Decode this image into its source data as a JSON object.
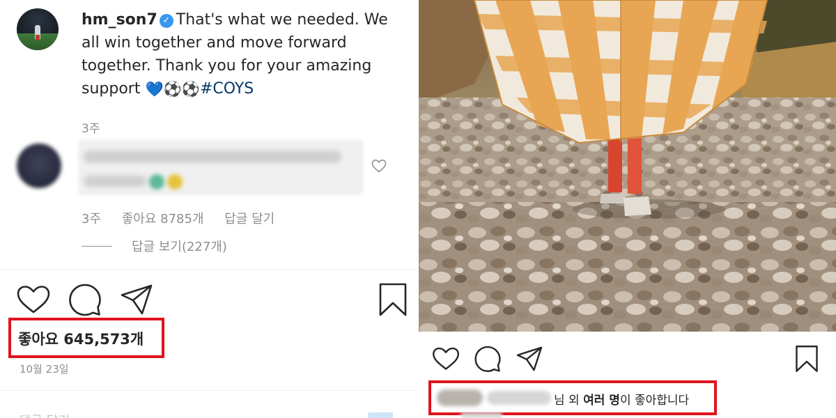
{
  "left_post": {
    "username": "hm_son7",
    "caption_text": "That's what we needed. We all win together and move forward together. Thank you for your amazing support",
    "emojis": [
      "💙",
      "⚽",
      "⚽"
    ],
    "hashtag": "#COYS",
    "caption_time": "3주",
    "comment": {
      "time": "3주",
      "likes": "좋아요 8785개",
      "reply_label": "답글 달기",
      "view_replies": "답글 보기(227개)"
    },
    "likes": "좋아요 645,573개",
    "date": "10월 23일",
    "cut_text": "댓글 달기..."
  },
  "right_post": {
    "likes_suffix_1": "님 외 ",
    "likes_bold": "여러 명",
    "likes_suffix_2": "이 좋아합니다"
  },
  "icons": {
    "like": "heart-icon",
    "comment": "comment-icon",
    "share": "send-icon",
    "save": "bookmark-icon",
    "verified": "verified-badge-icon"
  },
  "colors": {
    "highlight": "#e0141d",
    "verified": "#3897f0",
    "hashtag": "#00376b",
    "secondary_text": "#8e8e8e"
  }
}
